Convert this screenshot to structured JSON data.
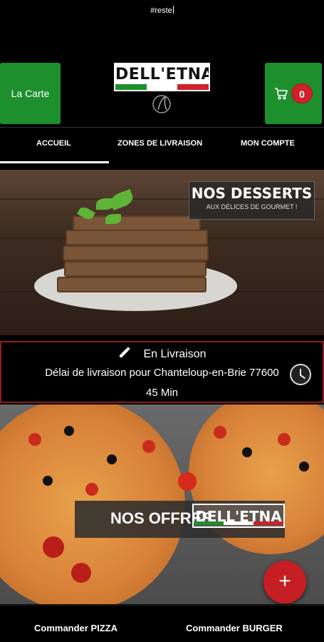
{
  "status": {
    "text": "#reste"
  },
  "header": {
    "carte_label": "La Carte",
    "logo_text": "DELL'ETNA",
    "cart_count": "0",
    "flag_colors": [
      "#1e8f2d",
      "#ffffff",
      "#d0202a"
    ]
  },
  "nav": {
    "items": [
      {
        "label": "ACCUEIL"
      },
      {
        "label": "ZONES DE LIVRAISON"
      },
      {
        "label": "MON COMPTE"
      }
    ]
  },
  "desserts_banner": {
    "title": "NOS DESSERTS",
    "subtitle": "AUX DÉLICES DE GOURMET !"
  },
  "delivery": {
    "mode": "En Livraison",
    "delay_text": "Délai de livraison pour Chanteloup-en-Brie 77600",
    "duration": "45 Min"
  },
  "offres_banner": {
    "title": "NOS OFFRES",
    "logo_text": "DELL'ETNA"
  },
  "fab": {
    "symbol": "+"
  },
  "bottom_bar": {
    "pizza_label": "Commander PIZZA",
    "burger_label": "Commander BURGER"
  },
  "colors": {
    "accent_green": "#1e8f2d",
    "accent_red": "#c51f24",
    "background": "#000000"
  }
}
